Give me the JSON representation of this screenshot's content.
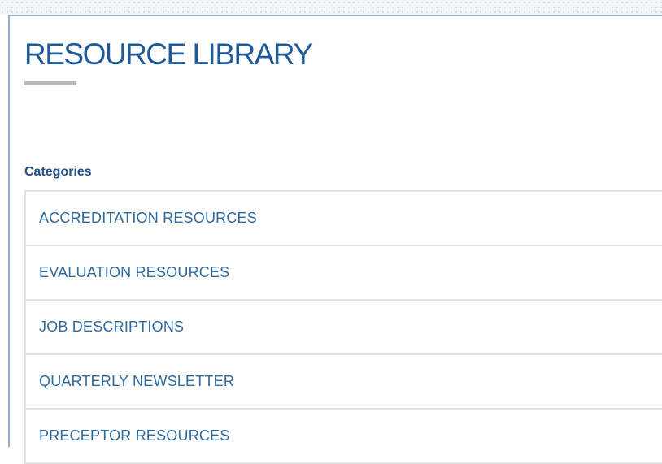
{
  "page": {
    "title": "RESOURCE LIBRARY"
  },
  "categories": {
    "heading": "Categories",
    "items": [
      {
        "label": "ACCREDITATION RESOURCES"
      },
      {
        "label": "EVALUATION RESOURCES"
      },
      {
        "label": "JOB DESCRIPTIONS"
      },
      {
        "label": "QUARTERLY NEWSLETTER"
      },
      {
        "label": "PRECEPTOR RESOURCES"
      }
    ]
  },
  "colors": {
    "title": "#1f5a96",
    "link": "#2f6a9f",
    "heading": "#1f4f86",
    "panel_border": "#8fb0d3",
    "divider": "#e2e2e2"
  }
}
